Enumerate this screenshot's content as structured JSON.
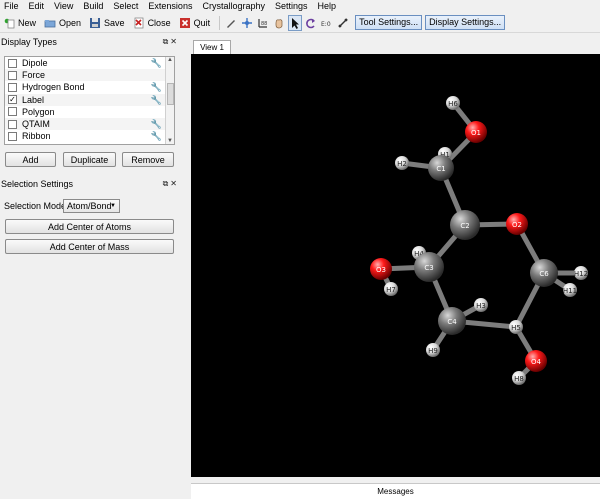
{
  "menubar": {
    "items": [
      "File",
      "Edit",
      "View",
      "Build",
      "Select",
      "Extensions",
      "Crystallography",
      "Settings",
      "Help"
    ]
  },
  "toolbar": {
    "new_label": "New",
    "open_label": "Open",
    "save_label": "Save",
    "close_label": "Close",
    "quit_label": "Quit",
    "tool_settings_label": "Tool Settings...",
    "display_settings_label": "Display Settings..."
  },
  "display_types": {
    "title": "Display Types",
    "items": [
      {
        "label": "Dipole",
        "checked": false,
        "has_settings": true
      },
      {
        "label": "Force",
        "checked": false,
        "has_settings": false
      },
      {
        "label": "Hydrogen Bond",
        "checked": false,
        "has_settings": true
      },
      {
        "label": "Label",
        "checked": true,
        "has_settings": true
      },
      {
        "label": "Polygon",
        "checked": false,
        "has_settings": false
      },
      {
        "label": "QTAIM",
        "checked": false,
        "has_settings": true
      },
      {
        "label": "Ribbon",
        "checked": false,
        "has_settings": true
      }
    ],
    "add_label": "Add",
    "duplicate_label": "Duplicate",
    "remove_label": "Remove"
  },
  "selection_settings": {
    "title": "Selection Settings",
    "mode_label": "Selection Mode:",
    "mode_value": "Atom/Bond",
    "center_atoms_label": "Add Center of Atoms",
    "center_mass_label": "Add Center of Mass"
  },
  "view": {
    "tab_label": "View 1"
  },
  "molecule": {
    "atom_labels": [
      "H6",
      "O1",
      "H1",
      "H2",
      "C1",
      "C2",
      "O2",
      "H4",
      "C3",
      "O3",
      "H7",
      "C6",
      "H12",
      "H11",
      "C4",
      "H3",
      "H5",
      "H9",
      "O4",
      "H8"
    ]
  },
  "messages_label": "Messages"
}
